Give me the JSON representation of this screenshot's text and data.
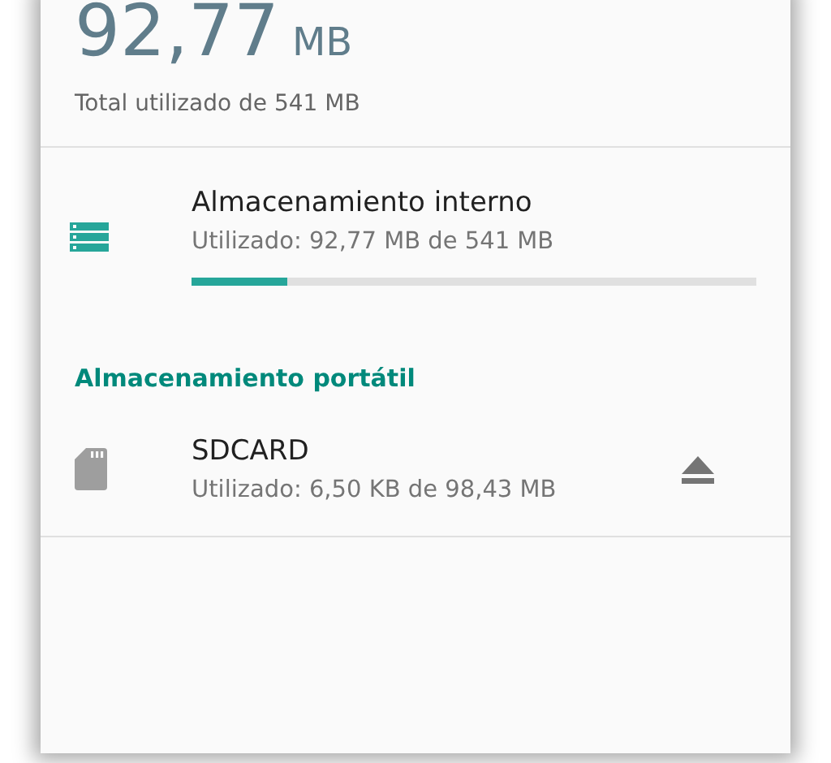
{
  "summary": {
    "amount": "92,77",
    "unit": "MB",
    "caption": "Total utilizado de 541 MB"
  },
  "internal": {
    "title": "Almacenamiento interno",
    "detail": "Utilizado: 92,77 MB de 541 MB",
    "level": 0.17
  },
  "portable": {
    "header": "Almacenamiento portátil",
    "devices": [
      {
        "title": "SDCARD",
        "detail": "Utilizado: 6,50 KB de 98,43 MB",
        "ejectable": true
      }
    ]
  }
}
